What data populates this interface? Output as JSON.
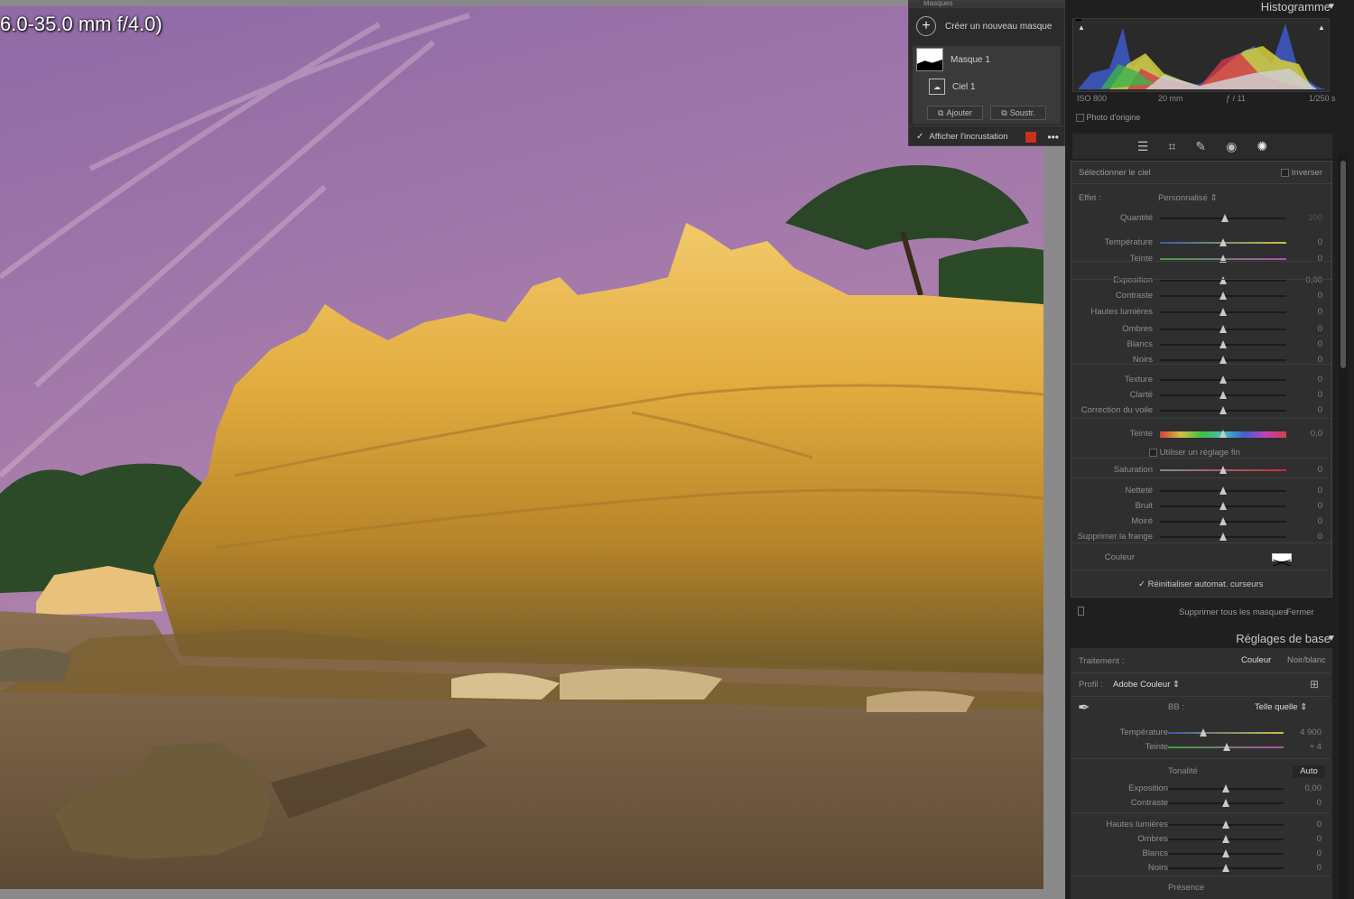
{
  "lens_text": "6.0-35.0 mm f/4.0)",
  "masks": {
    "title": "Masques",
    "create_label": "Créer un nouveau masque",
    "mask1": "Masque 1",
    "sky1": "Ciel 1",
    "add_label": "Ajouter",
    "subtract_label": "Soustr.",
    "overlay_label": "Afficher l'incrustation",
    "overlay_color": "#c8301f"
  },
  "histogram": {
    "title": "Histogramme",
    "iso": "ISO 800",
    "focal": "20 mm",
    "aperture": "ƒ / 11",
    "shutter": "1/250 s",
    "original_label": "Photo d'origine"
  },
  "mask_panel": {
    "title": "Sélectionner le ciel",
    "invert": "Inverser",
    "effect_label": "Effet :",
    "effect_value": "Personnalisé",
    "amount_label": "Quantité",
    "amount_value": "100",
    "sliders": [
      {
        "label": "Température",
        "value": "0",
        "pos": 0.5
      },
      {
        "label": "Teinte",
        "value": "0",
        "pos": 0.5
      },
      {
        "label": "Exposition",
        "value": "0,00",
        "pos": 0.5
      },
      {
        "label": "Contraste",
        "value": "0",
        "pos": 0.5
      },
      {
        "label": "Hautes lumières",
        "value": "0",
        "pos": 0.5
      },
      {
        "label": "Ombres",
        "value": "0",
        "pos": 0.5
      },
      {
        "label": "Blancs",
        "value": "0",
        "pos": 0.5
      },
      {
        "label": "Noirs",
        "value": "0",
        "pos": 0.5
      },
      {
        "label": "Texture",
        "value": "0",
        "pos": 0.5
      },
      {
        "label": "Clarté",
        "value": "0",
        "pos": 0.5
      },
      {
        "label": "Correction du voile",
        "value": "0",
        "pos": 0.5
      },
      {
        "label": "Teinte",
        "value": "0,0",
        "pos": 0.5
      },
      {
        "label": "Saturation",
        "value": "0",
        "pos": 0.5
      },
      {
        "label": "Netteté",
        "value": "0",
        "pos": 0.5
      },
      {
        "label": "Bruit",
        "value": "0",
        "pos": 0.5
      },
      {
        "label": "Moiré",
        "value": "0",
        "pos": 0.5
      },
      {
        "label": "Supprimer la frange",
        "value": "0",
        "pos": 0.5
      }
    ],
    "fine_tune": "Utiliser un réglage fin",
    "color_label": "Couleur",
    "reset_label": "Réinitialiser automat. curseurs",
    "delete_all": "Supprimer tous les masques",
    "close": "Fermer"
  },
  "basic": {
    "title": "Réglages de base",
    "treatment_label": "Traitement :",
    "color": "Couleur",
    "bw": "Noir/blanc",
    "profile_label": "Profil :",
    "profile_value": "Adobe Couleur",
    "wb_label": "BB :",
    "wb_value": "Telle quelle",
    "temp_label": "Température",
    "temp_value": "4 900",
    "tint_label": "Teinte",
    "tint_value": "+ 4",
    "tonality": "Tonalité",
    "auto": "Auto",
    "tone_sliders": [
      {
        "label": "Exposition",
        "value": "0,00"
      },
      {
        "label": "Contraste",
        "value": "0"
      },
      {
        "label": "Hautes lumières",
        "value": "0"
      },
      {
        "label": "Ombres",
        "value": "0"
      },
      {
        "label": "Blancs",
        "value": "0"
      },
      {
        "label": "Noirs",
        "value": "0"
      }
    ],
    "presence": "Présence"
  }
}
